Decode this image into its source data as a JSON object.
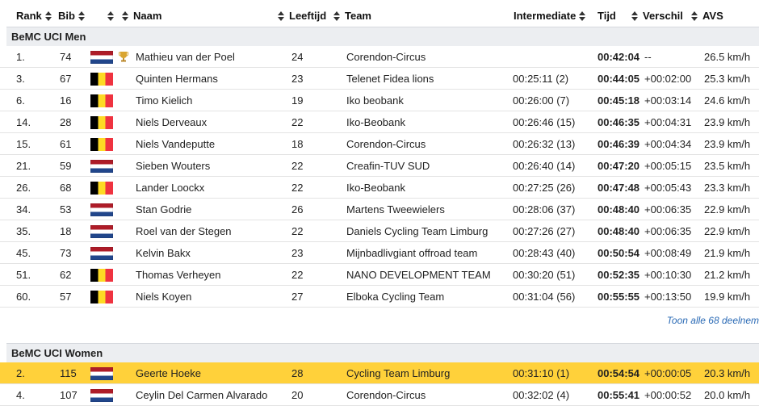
{
  "columns": {
    "rank": "Rank",
    "bib": "Bib",
    "naam": "Naam",
    "leeftijd": "Leeftijd",
    "team": "Team",
    "intermediate": "Intermediate",
    "tijd": "Tijd",
    "verschil": "Verschil",
    "avs": "AVS"
  },
  "groups": [
    {
      "title": "BeMC UCI Men",
      "rows": [
        {
          "rank": "1.",
          "bib": "74",
          "flag": "nl",
          "leader": true,
          "name": "Mathieu van der Poel",
          "age": "24",
          "team": "Corendon-Circus",
          "intermediate": "",
          "time": "00:42:04",
          "diff": "--",
          "avs": "26.5 km/h"
        },
        {
          "rank": "3.",
          "bib": "67",
          "flag": "be",
          "name": "Quinten Hermans",
          "age": "23",
          "team": "Telenet Fidea lions",
          "intermediate": "00:25:11 (2)",
          "time": "00:44:05",
          "diff": "+00:02:00",
          "avs": "25.3 km/h"
        },
        {
          "rank": "6.",
          "bib": "16",
          "flag": "be",
          "name": "Timo Kielich",
          "age": "19",
          "team": "Iko beobank",
          "intermediate": "00:26:00 (7)",
          "time": "00:45:18",
          "diff": "+00:03:14",
          "avs": "24.6 km/h"
        },
        {
          "rank": "14.",
          "bib": "28",
          "flag": "be",
          "name": "Niels Derveaux",
          "age": "22",
          "team": "Iko-Beobank",
          "intermediate": "00:26:46 (15)",
          "time": "00:46:35",
          "diff": "+00:04:31",
          "avs": "23.9 km/h"
        },
        {
          "rank": "15.",
          "bib": "61",
          "flag": "be",
          "name": "Niels Vandeputte",
          "age": "18",
          "team": "Corendon-Circus",
          "intermediate": "00:26:32 (13)",
          "time": "00:46:39",
          "diff": "+00:04:34",
          "avs": "23.9 km/h"
        },
        {
          "rank": "21.",
          "bib": "59",
          "flag": "nl",
          "name": "Sieben Wouters",
          "age": "22",
          "team": "Creafin-TUV SUD",
          "intermediate": "00:26:40 (14)",
          "time": "00:47:20",
          "diff": "+00:05:15",
          "avs": "23.5 km/h"
        },
        {
          "rank": "26.",
          "bib": "68",
          "flag": "be",
          "name": "Lander Loockx",
          "age": "22",
          "team": "Iko-Beobank",
          "intermediate": "00:27:25 (26)",
          "time": "00:47:48",
          "diff": "+00:05:43",
          "avs": "23.3 km/h"
        },
        {
          "rank": "34.",
          "bib": "53",
          "flag": "nl",
          "name": "Stan Godrie",
          "age": "26",
          "team": "Martens Tweewielers",
          "intermediate": "00:28:06 (37)",
          "time": "00:48:40",
          "diff": "+00:06:35",
          "avs": "22.9 km/h"
        },
        {
          "rank": "35.",
          "bib": "18",
          "flag": "nl",
          "name": "Roel van der Stegen",
          "age": "22",
          "team": "Daniels Cycling Team Limburg",
          "intermediate": "00:27:26 (27)",
          "time": "00:48:40",
          "diff": "+00:06:35",
          "avs": "22.9 km/h"
        },
        {
          "rank": "45.",
          "bib": "73",
          "flag": "nl",
          "name": "Kelvin Bakx",
          "age": "23",
          "team": "Mijnbadlivgiant offroad team",
          "intermediate": "00:28:43 (40)",
          "time": "00:50:54",
          "diff": "+00:08:49",
          "avs": "21.9 km/h"
        },
        {
          "rank": "51.",
          "bib": "62",
          "flag": "be",
          "name": "Thomas Verheyen",
          "age": "22",
          "team": "NANO DEVELOPMENT TEAM",
          "intermediate": "00:30:20 (51)",
          "time": "00:52:35",
          "diff": "+00:10:30",
          "avs": "21.2 km/h"
        },
        {
          "rank": "60.",
          "bib": "57",
          "flag": "be",
          "name": "Niels Koyen",
          "age": "27",
          "team": "Elboka Cycling Team",
          "intermediate": "00:31:04 (56)",
          "time": "00:55:55",
          "diff": "+00:13:50",
          "avs": "19.9 km/h"
        }
      ],
      "more_link": "Toon alle 68 deelnem"
    },
    {
      "title": "BeMC UCI Women",
      "rows": [
        {
          "rank": "2.",
          "bib": "115",
          "flag": "nl",
          "highlight": true,
          "name": "Geerte Hoeke",
          "age": "28",
          "team": "Cycling Team Limburg",
          "intermediate": "00:31:10 (1)",
          "time": "00:54:54",
          "diff": "+00:00:05",
          "avs": "20.3 km/h"
        },
        {
          "rank": "4.",
          "bib": "107",
          "flag": "nl",
          "name": "Ceylin Del Carmen Alvarado",
          "age": "20",
          "team": "Corendon-Circus",
          "intermediate": "00:32:02 (4)",
          "time": "00:55:41",
          "diff": "+00:00:52",
          "avs": "20.0 km/h"
        }
      ]
    }
  ]
}
